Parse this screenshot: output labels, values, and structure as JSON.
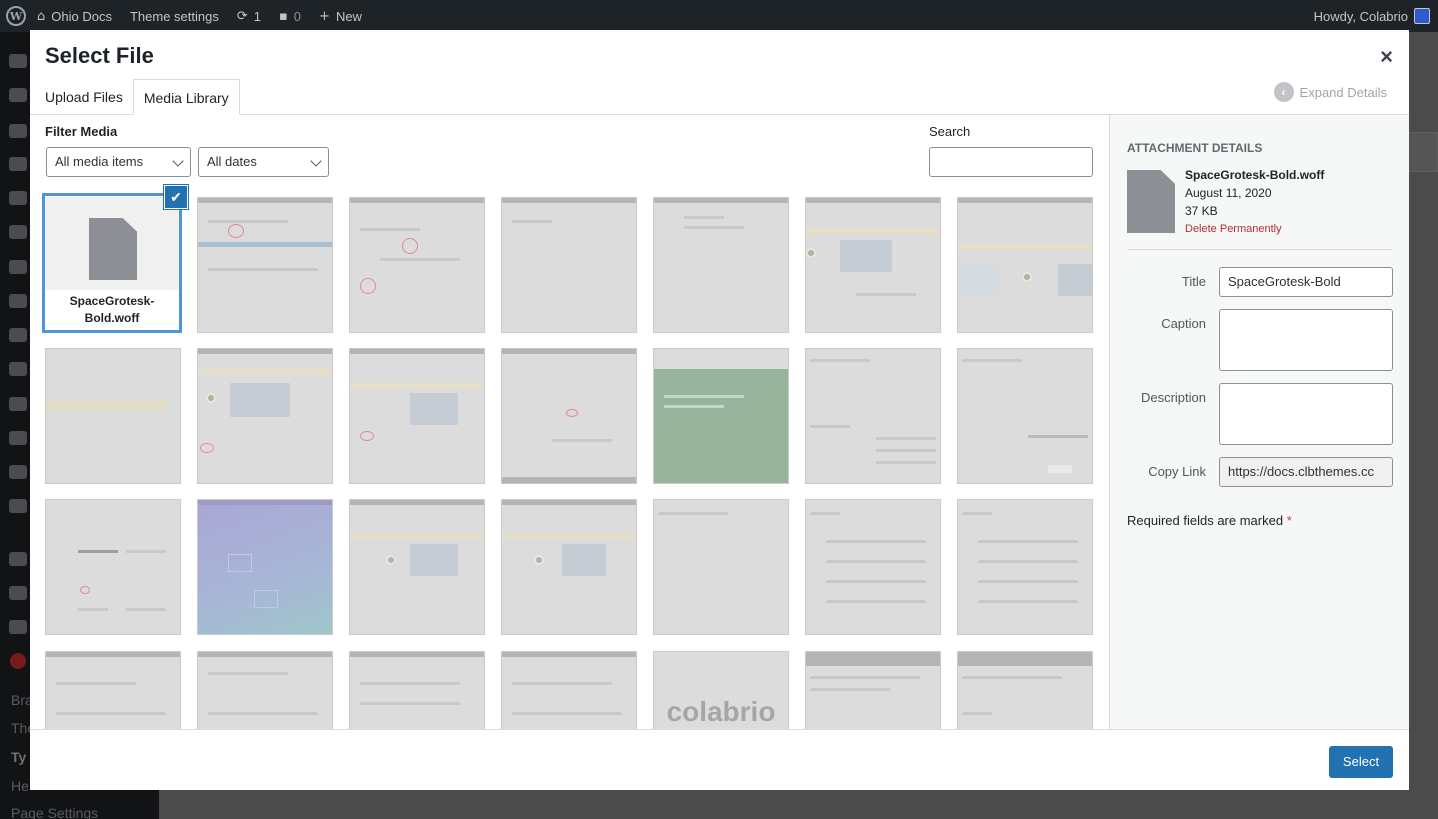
{
  "adminbar": {
    "site_name": "Ohio Docs",
    "theme_settings": "Theme settings",
    "updates_count": "1",
    "comments_count": "0",
    "new_label": "New",
    "howdy": "Howdy, Colabrio"
  },
  "admin_menu": {
    "visible_labels": [
      "Bra",
      "The",
      "Ty",
      "He",
      "Page Settings"
    ]
  },
  "modal": {
    "title": "Select File",
    "close_symbol": "×",
    "tabs": [
      {
        "label": "Upload Files",
        "active": false
      },
      {
        "label": "Media Library",
        "active": true
      }
    ],
    "expand_details": "Expand Details"
  },
  "filters": {
    "heading": "Filter Media",
    "type_select": {
      "value": "All media items"
    },
    "date_select": {
      "value": "All dates"
    },
    "search_label": "Search",
    "search_value": ""
  },
  "grid": {
    "selected_item": {
      "filename": "SpaceGrotesk-Bold.woff",
      "checked": true
    },
    "thumbnail_text": {
      "colabrio_logo": "colabrio"
    }
  },
  "details": {
    "heading": "Attachment Details",
    "filename": "SpaceGrotesk-Bold.woff",
    "date": "August 11, 2020",
    "size": "37 KB",
    "delete_label": "Delete Permanently",
    "fields": {
      "title_label": "Title",
      "title_value": "SpaceGrotesk-Bold",
      "caption_label": "Caption",
      "caption_value": "",
      "description_label": "Description",
      "description_value": "",
      "copy_link_label": "Copy Link",
      "copy_link_value": "https://docs.clbthemes.cc"
    },
    "required_note": "Required fields are marked",
    "required_star": "*"
  },
  "footer": {
    "select_button": "Select"
  },
  "colors": {
    "accent": "#2271b1",
    "selection_border": "#4f94d4",
    "delete_red": "#b32d2e",
    "adminbar_bg": "#1d2327"
  }
}
